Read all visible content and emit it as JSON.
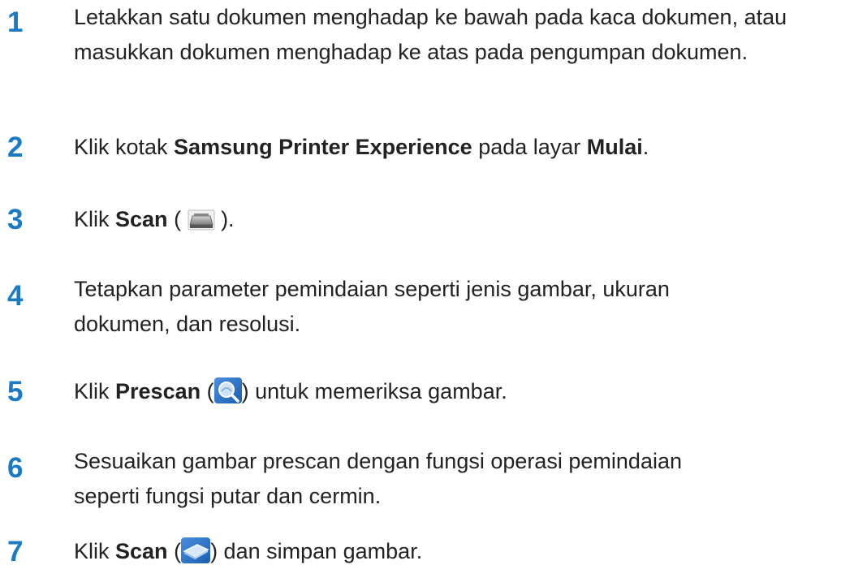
{
  "steps": [
    {
      "number": "1",
      "text": "Letakkan satu dokumen menghadap ke bawah pada kaca dokumen, atau masukkan dokumen menghadap ke atas pada pengumpan dokumen."
    },
    {
      "number": "2",
      "pre": "Klik kotak ",
      "bold1": "Samsung Printer Experience",
      "mid": " pada layar ",
      "bold2": "Mulai",
      "post": "."
    },
    {
      "number": "3",
      "pre": "Klik ",
      "bold": "Scan",
      "paren_open": " ( ",
      "icon": "scanner-icon",
      "paren_close": " )."
    },
    {
      "number": "4",
      "text": "Tetapkan parameter pemindaian seperti jenis gambar, ukuran dokumen, dan resolusi."
    },
    {
      "number": "5",
      "pre": "Klik ",
      "bold": "Prescan",
      "paren_open": " (",
      "icon": "prescan-magnifier-icon",
      "paren_close": ") untuk memeriksa gambar."
    },
    {
      "number": "6",
      "text": "Sesuaikan gambar prescan dengan fungsi operasi pemindaian seperti fungsi putar dan cermin."
    },
    {
      "number": "7",
      "pre": "Klik ",
      "bold": "Scan",
      "paren_open": " (",
      "icon": "scan-device-icon",
      "paren_close": ") dan simpan gambar."
    }
  ],
  "colors": {
    "step_number": "#1a7ac4",
    "text": "#222222",
    "icon_blue": "#2a6fc4"
  }
}
